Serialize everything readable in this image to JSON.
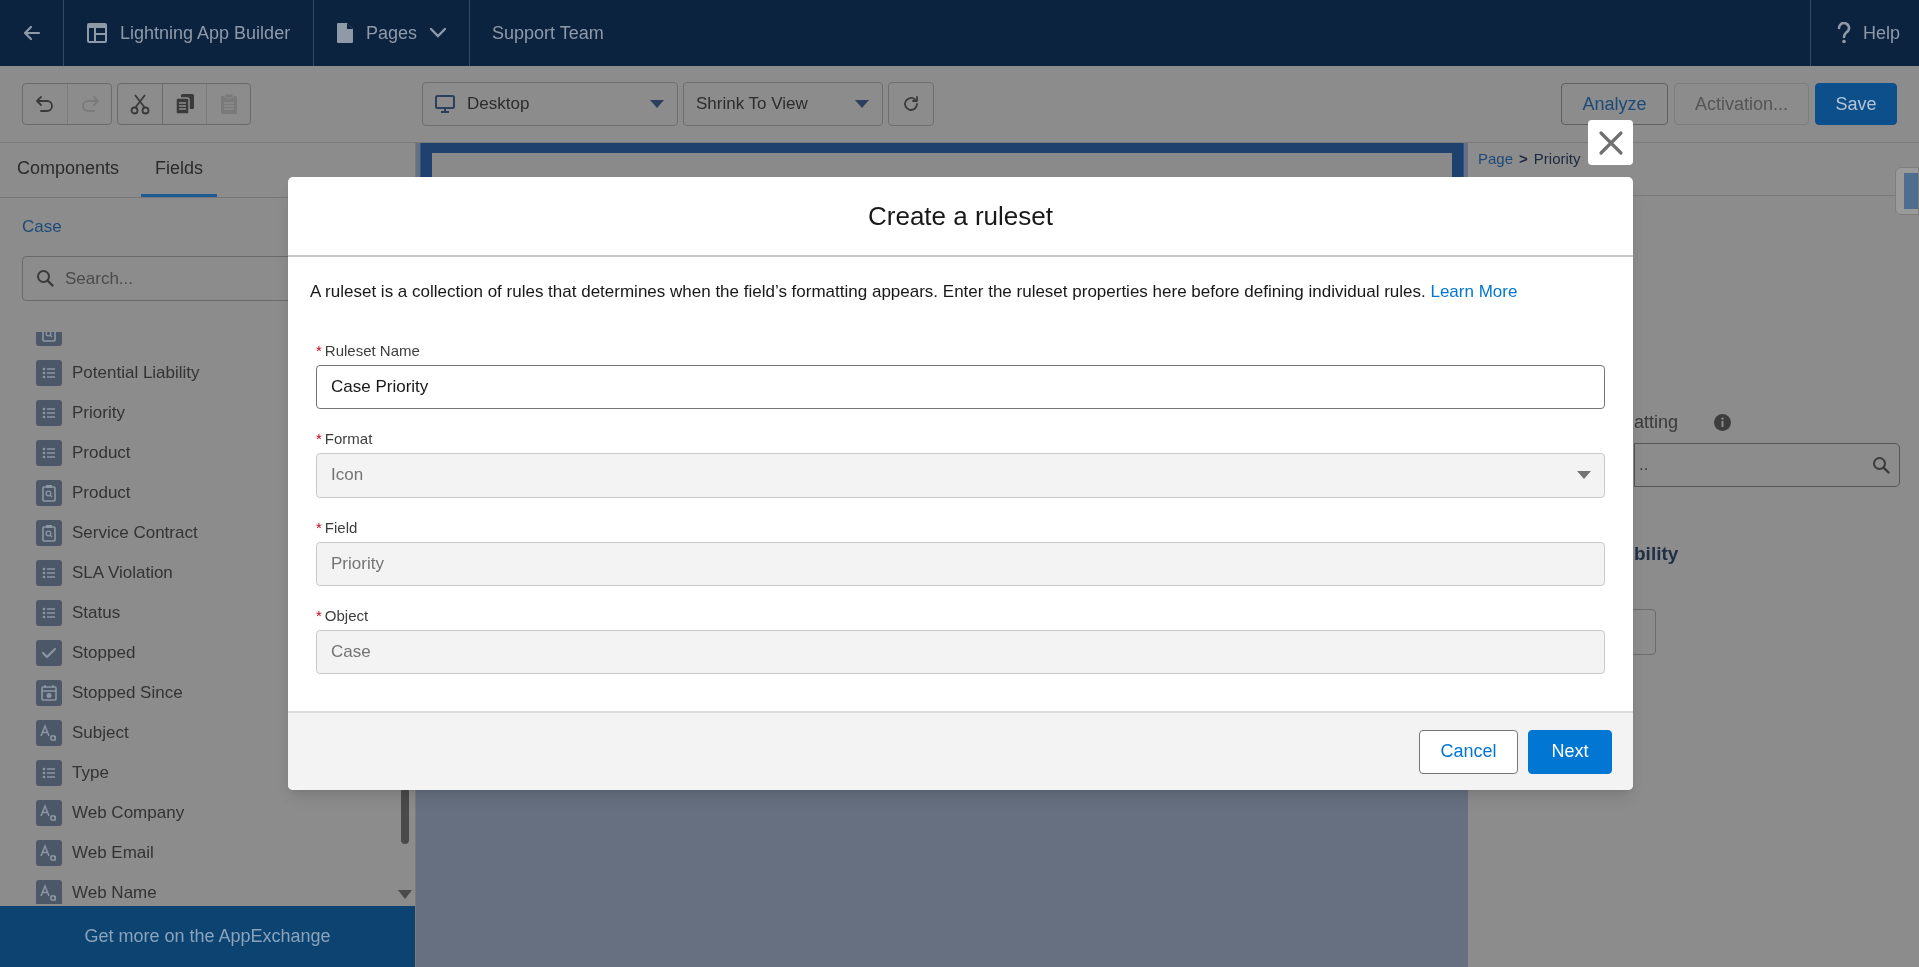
{
  "top_bar": {
    "back": {
      "kind": "back"
    },
    "items": [
      {
        "kind": "app",
        "label": "Lightning App Builder"
      },
      {
        "kind": "pages",
        "label": "Pages"
      },
      {
        "kind": "plain",
        "label": "Support Team"
      }
    ],
    "help": "Help"
  },
  "toolbar": {
    "groups": [
      [
        {
          "kind": "undo",
          "disabled": false
        },
        {
          "kind": "redo",
          "disabled": true
        }
      ],
      [
        {
          "kind": "cut",
          "disabled": false
        },
        {
          "kind": "copy",
          "disabled": false
        },
        {
          "kind": "paste",
          "disabled": true
        }
      ]
    ],
    "device": "Desktop",
    "zoom": "Shrink To View",
    "actions": [
      {
        "label": "Analyze",
        "kind": "outline",
        "disabled": false
      },
      {
        "label": "Activation...",
        "kind": "outline",
        "disabled": true
      },
      {
        "label": "Save",
        "kind": "brand",
        "disabled": false
      }
    ]
  },
  "left_panel": {
    "tabs": [
      {
        "label": "Components",
        "selected": false
      },
      {
        "label": "Fields",
        "selected": true
      }
    ],
    "object": "Case",
    "search": {
      "placeholder": "Search..."
    },
    "fields": [
      {
        "kind": "lookup"
      },
      {
        "kind": "picklist",
        "label": "Potential Liability"
      },
      {
        "kind": "picklist",
        "label": "Priority"
      },
      {
        "kind": "picklist",
        "label": "Product"
      },
      {
        "kind": "lookup",
        "label": "Product"
      },
      {
        "kind": "lookup",
        "label": "Service Contract"
      },
      {
        "kind": "picklist",
        "label": "SLA Violation"
      },
      {
        "kind": "picklist",
        "label": "Status"
      },
      {
        "kind": "checkbox",
        "label": "Stopped"
      },
      {
        "kind": "datetime",
        "label": "Stopped Since"
      },
      {
        "kind": "text",
        "label": "Subject"
      },
      {
        "kind": "picklist",
        "label": "Type"
      },
      {
        "kind": "text",
        "label": "Web Company"
      },
      {
        "kind": "text",
        "label": "Web Email"
      },
      {
        "kind": "text",
        "label": "Web Name"
      }
    ],
    "banner": "Get more on the AppExchange"
  },
  "right_panel": {
    "breadcrumb": [
      "Page",
      "Priority"
    ],
    "separator": ">",
    "label_fragment": "atting",
    "search": {
      "placeholder": ".."
    },
    "heading_fragment": "bility"
  },
  "modal": {
    "title": "Create a ruleset",
    "description": "A ruleset is a collection of rules that determines when the field’s formatting appears. Enter the ruleset properties here before defining individual rules.",
    "link": "Learn More",
    "fields": [
      {
        "label": "Ruleset Name",
        "required_mark": "*",
        "kind": "input",
        "value": "Case Priority"
      },
      {
        "label": "Format",
        "required_mark": "*",
        "kind": "select",
        "value": "Icon"
      },
      {
        "label": "Field",
        "required_mark": "*",
        "kind": "readonly",
        "value": "Priority"
      },
      {
        "label": "Object",
        "required_mark": "*",
        "kind": "readonly",
        "value": "Case"
      }
    ],
    "buttons": [
      {
        "label": "Cancel",
        "kind": "neutral"
      },
      {
        "label": "Next",
        "kind": "brand"
      }
    ]
  }
}
